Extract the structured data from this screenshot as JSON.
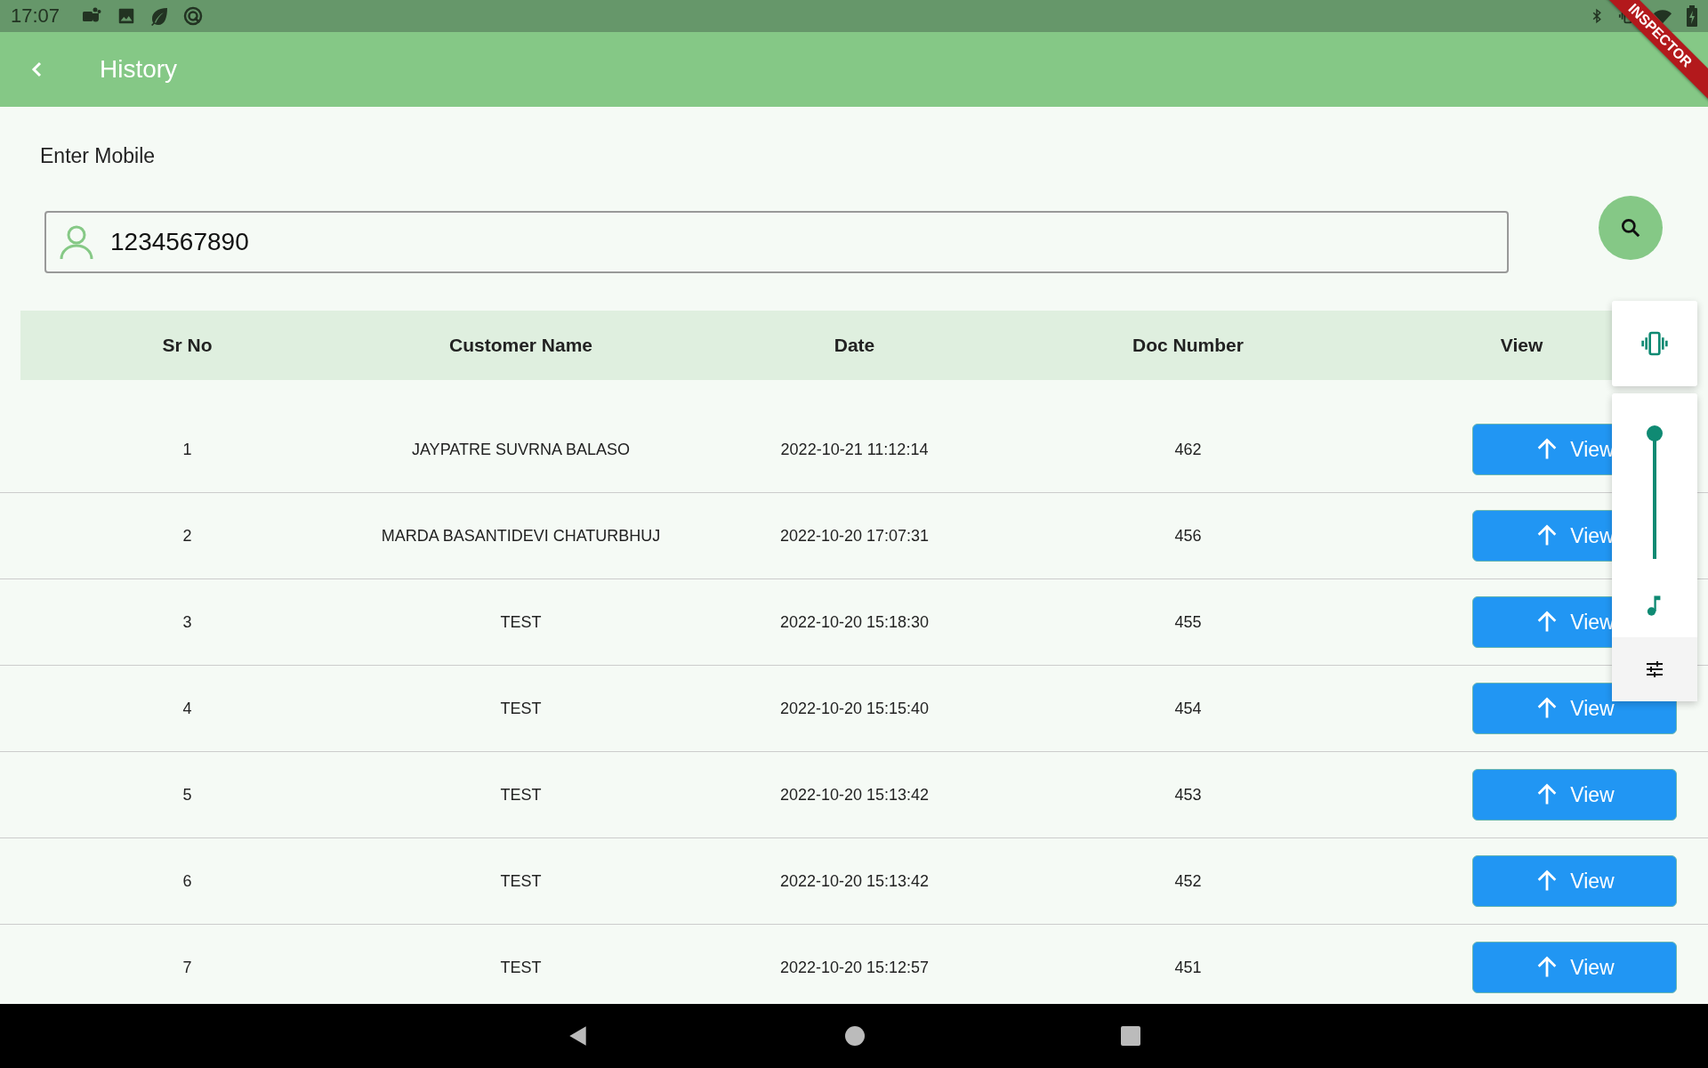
{
  "status_bar": {
    "time": "17:07"
  },
  "debug_banner": {
    "label": "INSPECTOR"
  },
  "app_bar": {
    "title": "History"
  },
  "search": {
    "label": "Enter Mobile",
    "value": "1234567890"
  },
  "table": {
    "columns": [
      "Sr No",
      "Customer Name",
      "Date",
      "Doc Number",
      "View"
    ],
    "rows": [
      {
        "sr_no": "1",
        "customer_name": "JAYPATRE SUVRNA BALASO",
        "date": "2022-10-21 11:12:14",
        "doc_number": "462",
        "action": "View"
      },
      {
        "sr_no": "2",
        "customer_name": "MARDA BASANTIDEVI CHATURBHUJ",
        "date": "2022-10-20 17:07:31",
        "doc_number": "456",
        "action": "View"
      },
      {
        "sr_no": "3",
        "customer_name": "TEST",
        "date": "2022-10-20 15:18:30",
        "doc_number": "455",
        "action": "View"
      },
      {
        "sr_no": "4",
        "customer_name": "TEST",
        "date": "2022-10-20 15:15:40",
        "doc_number": "454",
        "action": "View"
      },
      {
        "sr_no": "5",
        "customer_name": "TEST",
        "date": "2022-10-20 15:13:42",
        "doc_number": "453",
        "action": "View"
      },
      {
        "sr_no": "6",
        "customer_name": "TEST",
        "date": "2022-10-20 15:13:42",
        "doc_number": "452",
        "action": "View"
      },
      {
        "sr_no": "7",
        "customer_name": "TEST",
        "date": "2022-10-20 15:12:57",
        "doc_number": "451",
        "action": "View"
      }
    ]
  },
  "volume_panel": {
    "level": 1
  }
}
